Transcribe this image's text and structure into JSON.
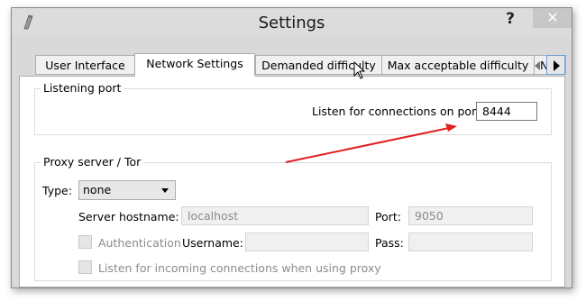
{
  "window": {
    "title": "Settings",
    "help_label": "?",
    "close_label": "✕"
  },
  "tabs": [
    {
      "label": "User Interface",
      "active": false
    },
    {
      "label": "Network Settings",
      "active": true
    },
    {
      "label": "Demanded difficulty",
      "active": false
    },
    {
      "label": "Max acceptable difficulty",
      "active": false
    },
    {
      "label": "Name",
      "active": false
    }
  ],
  "listening_port": {
    "group_title": "Listening port",
    "label": "Listen for connections on port:",
    "value": "8444"
  },
  "proxy": {
    "group_title": "Proxy server / Tor",
    "type_label": "Type:",
    "type_value": "none",
    "hostname_label": "Server hostname:",
    "hostname_value": "localhost",
    "port_label": "Port:",
    "port_value": "9050",
    "auth_label": "Authentication",
    "username_label": "Username:",
    "username_value": "",
    "pass_label": "Pass:",
    "pass_value": "",
    "incoming_label": "Listen for incoming connections when using proxy"
  },
  "colors": {
    "annotation_arrow": "#e02020"
  }
}
